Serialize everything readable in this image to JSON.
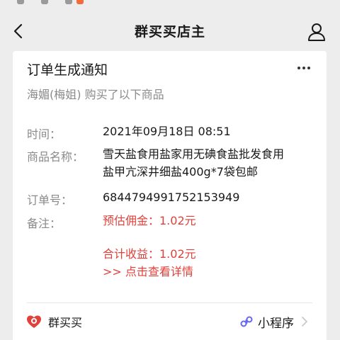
{
  "nav": {
    "title": "群买买店主"
  },
  "message": {
    "title": "订单生成通知",
    "subtitle": "海媚(梅姐) 购买了以下商品",
    "rows": [
      {
        "label": "时间：",
        "value": "2021年09月18日 08:51"
      },
      {
        "label": "商品名称：",
        "value_line1": "雪天盐食用盐家用无碘食盐批发食用",
        "value_line2": "盐甲亢深井细盐400g*7袋包邮"
      },
      {
        "label": "订单号：",
        "value": "6844794991752153949"
      },
      {
        "label": "备注：",
        "value": "预估佣金：1.02元"
      }
    ],
    "total": "合计收益：1.02元",
    "detail_link": ">> 点击查看详情"
  },
  "footer": {
    "app_name": "群买买",
    "mini_program_label": "小程序"
  },
  "colors": {
    "background": "#ededed",
    "card": "#ffffff",
    "highlight_red": "#e0413a",
    "muted_text": "#8a8a8a",
    "mini_program_purple": "#6467f0"
  }
}
